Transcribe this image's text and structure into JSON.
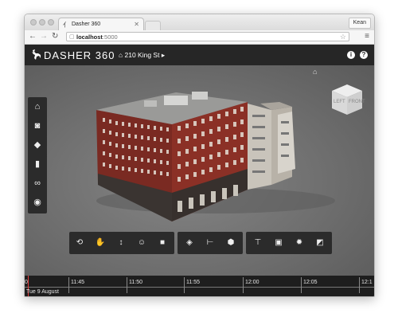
{
  "browser": {
    "tab_title": "Dasher 360",
    "tab_icon": "deer-icon",
    "user": "Kean",
    "url": "localhost:5000",
    "url_host": "localhost",
    "url_port": ":5000"
  },
  "app": {
    "title": "DASHER 360",
    "breadcrumb": "210 King St",
    "icons": [
      "info-icon",
      "help-icon"
    ]
  },
  "viewcube": {
    "left_label": "LEFT",
    "front_label": "FRONT"
  },
  "left_toolbar": [
    "home-icon",
    "dashboard-icon",
    "tag-icon",
    "bar-chart-icon",
    "glasses-icon",
    "eye-icon"
  ],
  "bottom_toolbar": {
    "group1": [
      "orbit-icon",
      "pan-hand-icon",
      "zoom-icon",
      "walk-icon",
      "camera-icon"
    ],
    "group2": [
      "section-icon",
      "measure-icon",
      "explode-icon"
    ],
    "group3": [
      "model-browser-icon",
      "properties-icon",
      "settings-icon",
      "fullscreen-icon"
    ]
  },
  "timeline": {
    "ticks": [
      "0",
      "11:45",
      "11:50",
      "11:55",
      "12:00",
      "12:05",
      "12:1"
    ],
    "date": "Tue 9 August"
  },
  "colors": {
    "header_bg": "#262626",
    "viewport_bg": "#6e6e6e",
    "toolbar_bg": "#2b2b2b",
    "timeline_marker": "#e23b3b",
    "brick": "#7a2a22"
  }
}
